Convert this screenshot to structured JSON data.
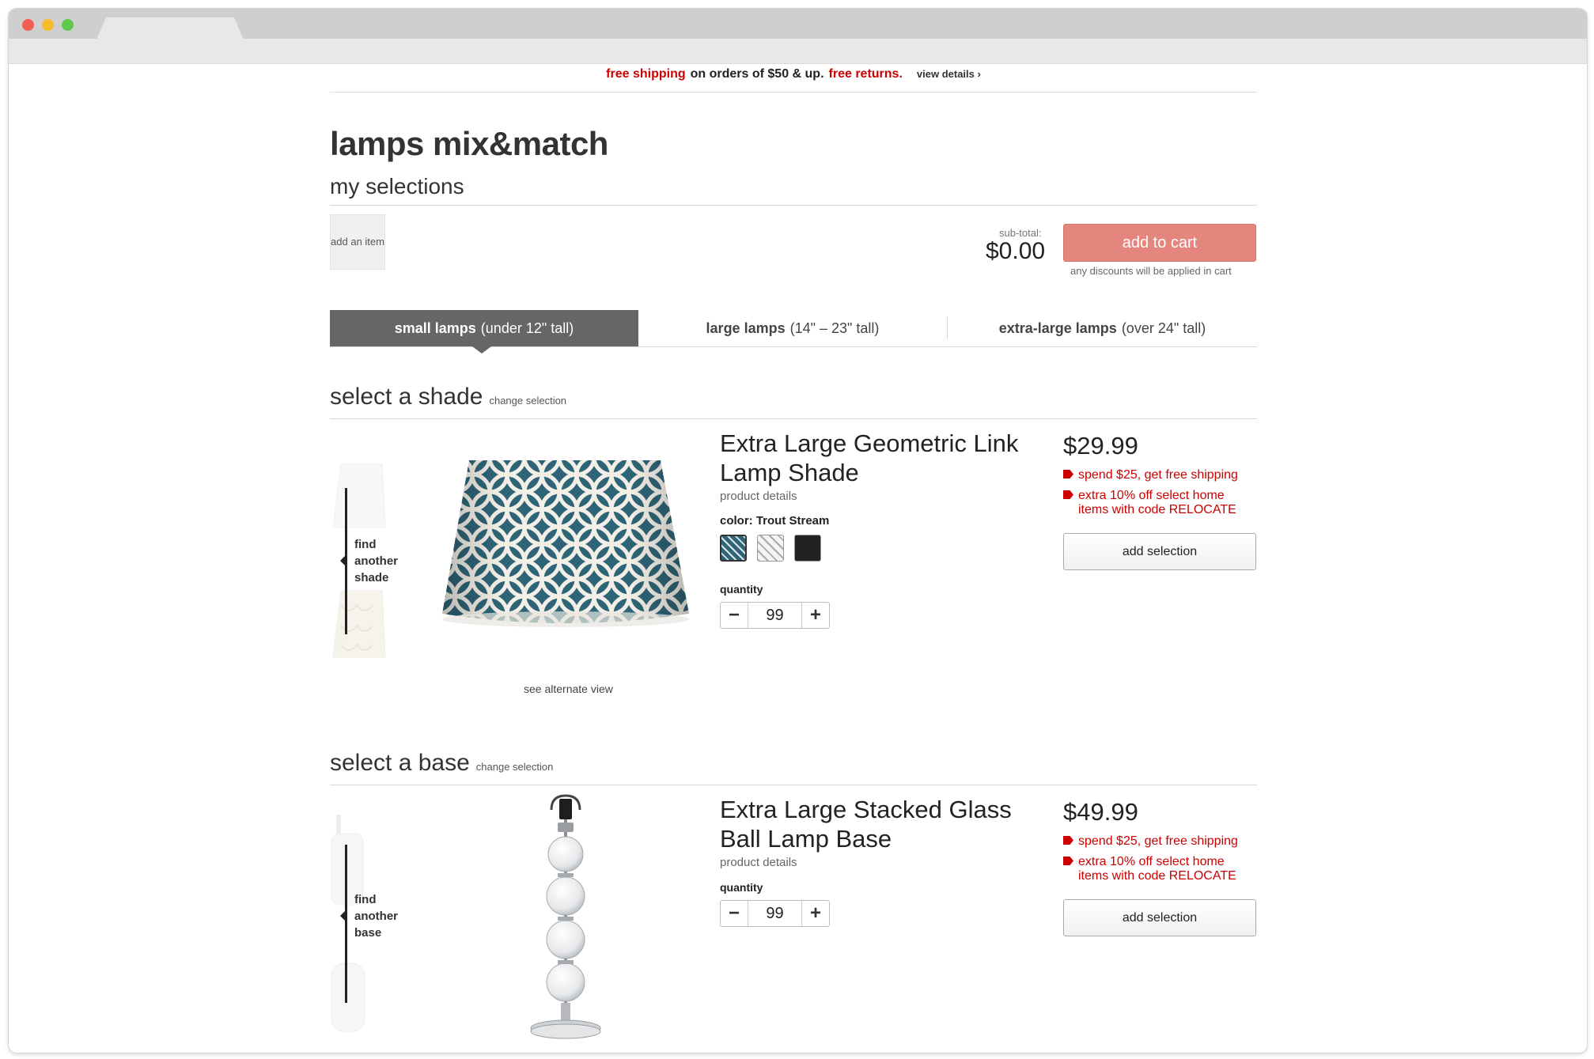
{
  "promo": {
    "free_shipping": "free shipping",
    "mid": "on orders of $50 & up.",
    "free_returns": "free returns.",
    "view_details": "view details ›"
  },
  "page": {
    "title": "lamps mix&match",
    "my_selections": "my selections",
    "add_item": "add an item",
    "subtotal_label": "sub-total:",
    "subtotal": "$0.00",
    "add_to_cart": "add to cart",
    "discount_note": "any discounts will be applied in cart"
  },
  "tabs": [
    {
      "bold": "small lamps",
      "rest": "(under 12\" tall)",
      "active": true
    },
    {
      "bold": "large lamps",
      "rest": "(14\" – 23\" tall)",
      "active": false
    },
    {
      "bold": "extra-large lamps",
      "rest": "(over 24\" tall)",
      "active": false
    }
  ],
  "shade": {
    "section_title": "select a shade",
    "change": "change selection",
    "finder": [
      "find",
      "another",
      "shade"
    ],
    "name_line1": "Extra Large Geometric Link",
    "name_line2": "Lamp Shade",
    "product_details": "product details",
    "color_label": "color: Trout Stream",
    "swatches": [
      "Trout Stream",
      "gray",
      "black"
    ],
    "quantity_label": "quantity",
    "quantity": "99",
    "price": "$29.99",
    "promo1": "spend $25, get free shipping",
    "promo2a": "extra 10% off select home",
    "promo2b": "items with code RELOCATE",
    "add_selection": "add selection",
    "alt_view": "see alternate view"
  },
  "base": {
    "section_title": "select a base",
    "change": "change selection",
    "finder": [
      "find",
      "another",
      "base"
    ],
    "name_line1": "Extra Large Stacked Glass",
    "name_line2": "Ball Lamp Base",
    "product_details": "product details",
    "quantity_label": "quantity",
    "quantity": "99",
    "price": "$49.99",
    "promo1": "spend $25, get free shipping",
    "promo2a": "extra 10% off select home",
    "promo2b": "items with code RELOCATE",
    "add_selection": "add selection"
  },
  "colors": {
    "accent_red": "#cc0000",
    "add_to_cart_bg": "#e4867e",
    "active_tab": "#666666",
    "shade_teal": "#2e6477"
  }
}
